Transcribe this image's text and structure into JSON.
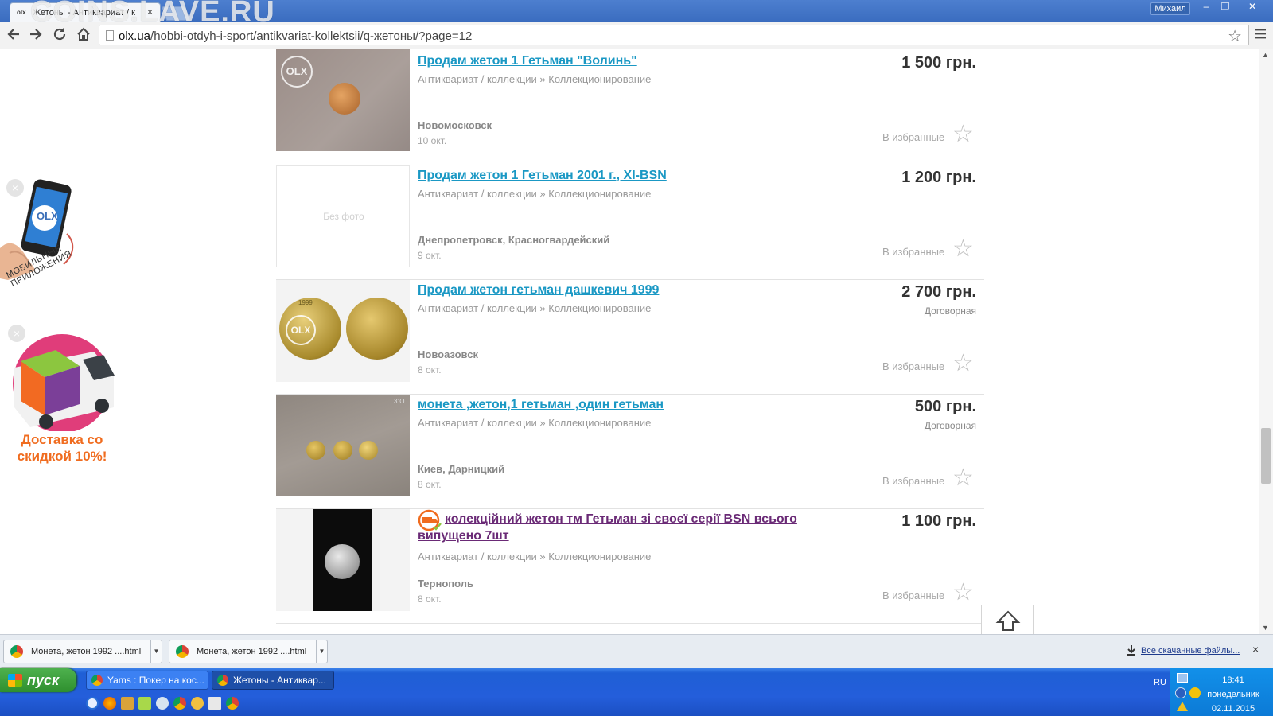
{
  "colors": {
    "title_link": "#1a98c4",
    "visited_link": "#6a2a76",
    "price": "#333333",
    "muted": "#999999",
    "promo_orange": "#f06c1f",
    "taskbar": "#245edb",
    "start_green": "#3aa13a"
  },
  "browser": {
    "tab_title": "Жетоны - Антиквариат / к",
    "tab_favicon": "olx",
    "tab_close": "×",
    "watermark": "COINS.LAVE.RU",
    "user_name": "Михаил",
    "window_buttons": [
      "–",
      "❐",
      "✕"
    ],
    "address_host": "olx.ua",
    "address_path": "/hobbi-otdyh-i-sport/antikvariat-kollektsii/q-жетоны/?page=12",
    "icons": [
      "back-arrow-icon",
      "forward-arrow-icon",
      "reload-icon",
      "home-icon",
      "bookmark-star-icon",
      "chrome-menu-icon"
    ]
  },
  "sidebar": {
    "app_promo_label": "МОБИЛЬНЫЕ ПРИЛОЖЕНИЯ",
    "delivery_promo_text": "Доставка со скидкой 10%!",
    "phone_logo": "OLX"
  },
  "listings": [
    {
      "title": "Продам жетон 1 Гетьман \"Волинь\"",
      "category": "Антиквариат / коллекции » Коллекционирование",
      "city": "Новомосковск",
      "date": "10 окт.",
      "price": "1 500 грн.",
      "negotiable": "",
      "favorite_label": "В избранные",
      "photo_watermark": "OLX"
    },
    {
      "title": "Продам жетон 1 Гетьман 2001 г., XI-BSN",
      "category": "Антиквариат / коллекции » Коллекционирование",
      "city": "Днепропетровск, Красногвардейский",
      "date": "9 окт.",
      "price": "1 200 грн.",
      "negotiable": "",
      "favorite_label": "В избранные",
      "no_photo": "Без фото"
    },
    {
      "title": "Продам жетон гетьман дашкевич 1999",
      "category": "Антиквариат / коллекции » Коллекционирование",
      "city": "Новоазовск",
      "date": "8 окт.",
      "price": "2 700 грн.",
      "negotiable": "Договорная",
      "favorite_label": "В избранные",
      "photo_watermark": "OLX",
      "coin_year": "1999"
    },
    {
      "title": "монета ,жетон,1 гетьман ,один гетьман",
      "category": "Антиквариат / коллекции » Коллекционирование",
      "city": "Киев, Дарницкий",
      "date": "8 окт.",
      "price": "500 грн.",
      "negotiable": "Договорная",
      "favorite_label": "В избранные",
      "photo_corner_text": "3\"O"
    },
    {
      "title": "колекційний жетон тм Гетьман зі своєї серії BSN всього випущено 7шт",
      "category": "Антиквариат / коллекции » Коллекционирование",
      "city": "Тернополь",
      "date": "8 окт.",
      "price": "1 100 грн.",
      "negotiable": "",
      "favorite_label": "В избранные",
      "visited": true,
      "delivery_badge": true
    }
  ],
  "downloads": {
    "items": [
      "Монета, жетон 1992 ....html",
      "Монета, жетон 1992 ....html"
    ],
    "show_all": "Все скачанные файлы...",
    "close": "×"
  },
  "taskbar": {
    "start_label": "пуск",
    "tasks": [
      "Yams : Покер на кос...",
      "Жетоны - Антиквар..."
    ],
    "lang": "RU",
    "clock_time": "18:41",
    "clock_day": "понедельник",
    "clock_date": "02.11.2015"
  }
}
